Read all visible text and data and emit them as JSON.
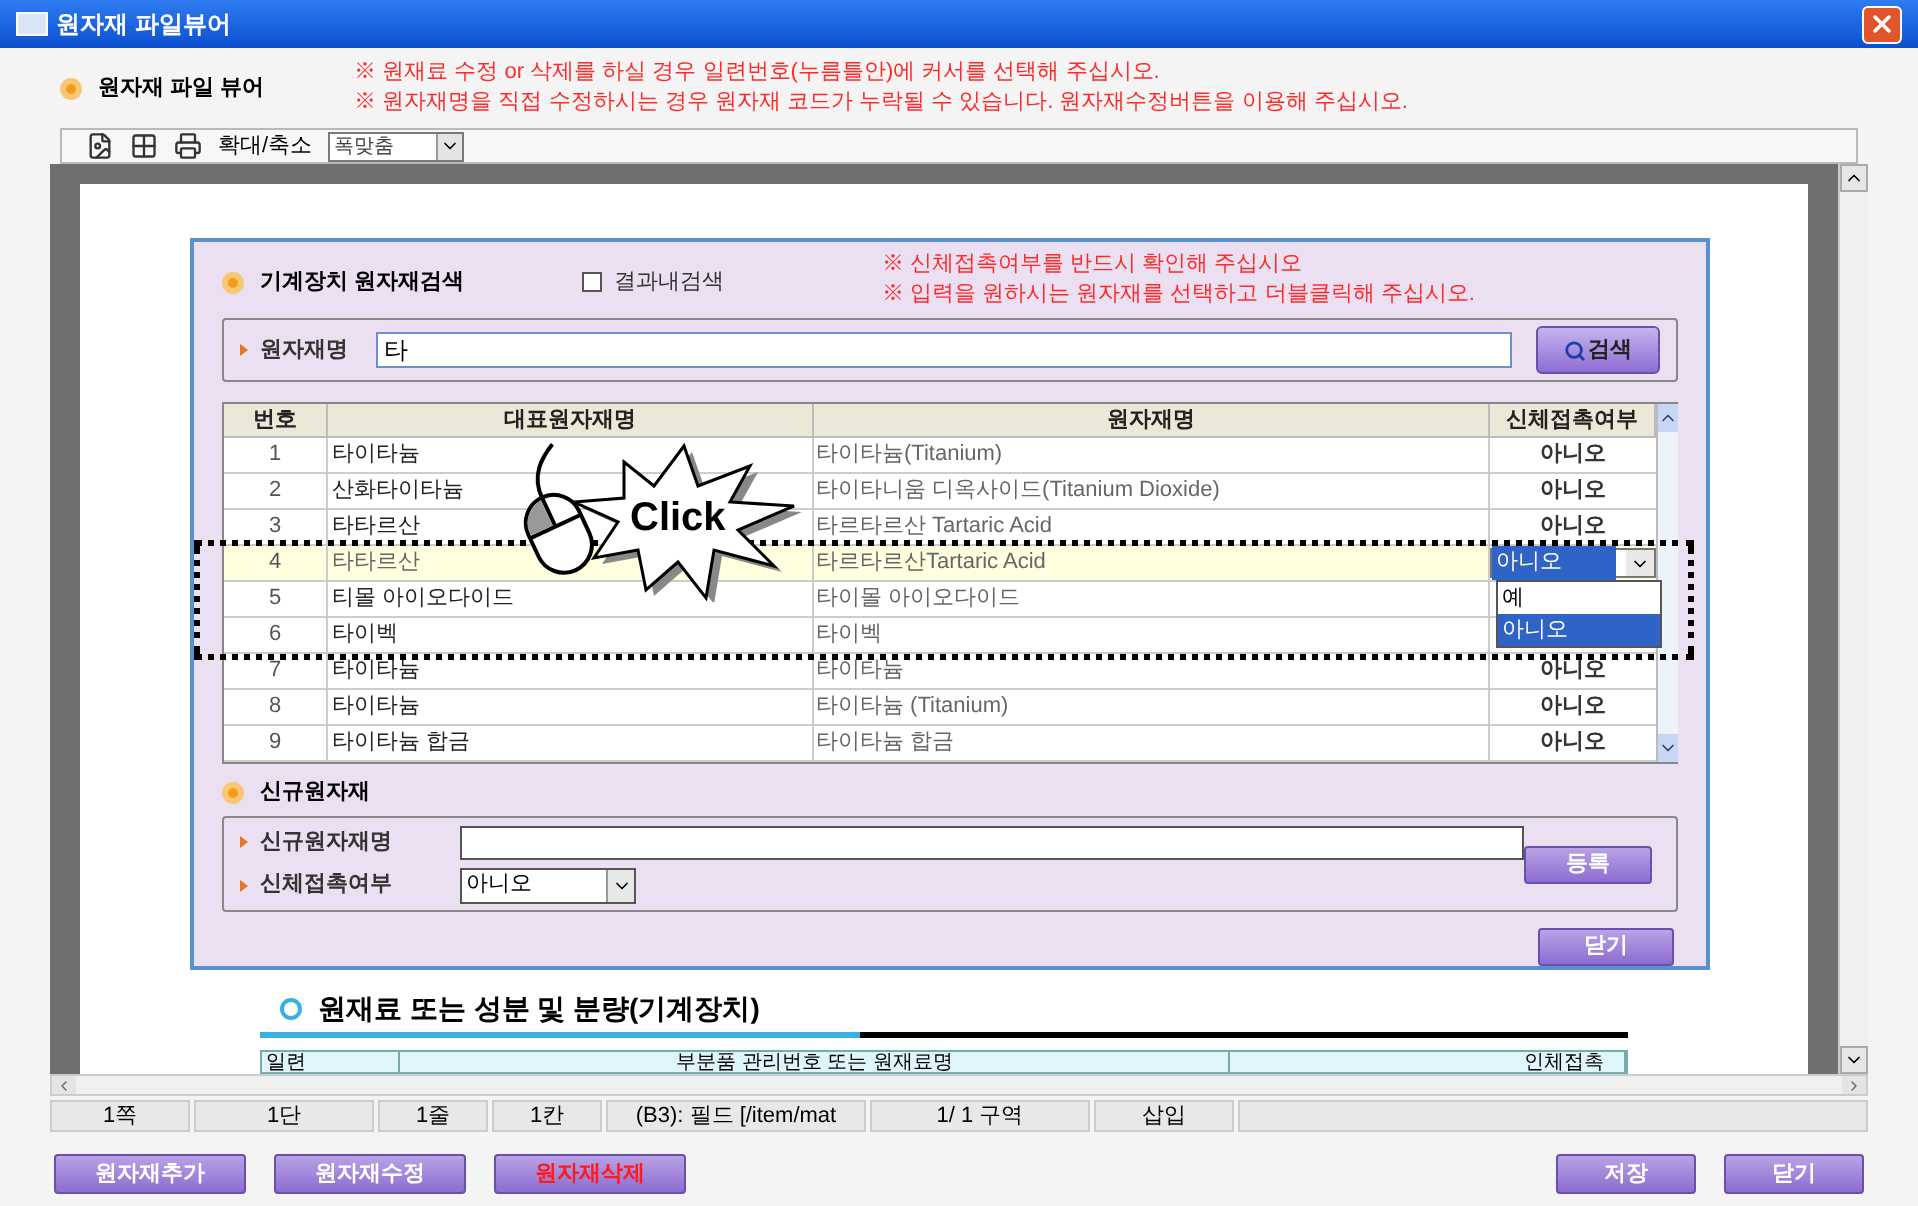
{
  "window": {
    "title": "원자재 파일뷰어"
  },
  "header": {
    "title": "원자재 파일 뷰어",
    "notes": [
      "※ 원재료 수정 or 삭제를 하실 경우 일련번호(누름틀안)에 커서를 선택해 주십시오.",
      "※ 원자재명을 직접 수정하시는 경우 원자재 코드가 누락될 수 있습니다. 원자재수정버튼을 이용해 주십시오."
    ]
  },
  "toolbar": {
    "zoom_label": "확대/축소",
    "zoom_value": "폭맞춤"
  },
  "search_dialog": {
    "title": "기계장치 원자재검색",
    "filter": {
      "label": "결과내검색",
      "checked": false
    },
    "notes": [
      "※ 신체접촉여부를 반드시 확인해 주십시오",
      "※ 입력을 원하시는 원자재를 선택하고 더블클릭해 주십시오."
    ],
    "search": {
      "label": "원자재명",
      "value": "타",
      "button": "검색"
    },
    "table": {
      "columns": [
        "번호",
        "대표원자재명",
        "원자재명",
        "신체접촉여부"
      ],
      "rows": [
        {
          "kind": "plain",
          "no": "1",
          "rep": "타이타늄",
          "name": "타이타늄(Titanium)",
          "contact": "아니오",
          "selected": false
        },
        {
          "kind": "plain",
          "no": "2",
          "rep": "산화타이타늄",
          "name": "타이타니움 디옥사이드(Titanium Dioxide)",
          "contact": "아니오",
          "selected": false
        },
        {
          "kind": "plain",
          "no": "3",
          "rep": "타타르산",
          "name": "타르타르산 Tartaric Acid",
          "contact": "아니오",
          "selected": false
        },
        {
          "kind": "editing",
          "no": "4",
          "rep": "타타르산",
          "name": "타르타르산Tartaric Acid",
          "contact": "아니오",
          "selected": true,
          "options": [
            {
              "label": "예",
              "selected": false
            },
            {
              "label": "아니오",
              "selected": true
            }
          ]
        },
        {
          "kind": "plain",
          "no": "5",
          "rep": "티몰 아이오다이드",
          "name": "타이몰 아이오다이드",
          "selected": false
        },
        {
          "kind": "plain",
          "no": "6",
          "rep": "타이벡",
          "name": "타이벡",
          "selected": false
        },
        {
          "kind": "plain",
          "no": "7",
          "rep": "타이타늄",
          "name": "타이타늄",
          "contact": "아니오",
          "selected": false
        },
        {
          "kind": "plain",
          "no": "8",
          "rep": "타이타늄",
          "name": "타이타늄 (Titanium)",
          "contact": "아니오",
          "selected": false
        },
        {
          "kind": "plain",
          "no": "9",
          "rep": "타이타늄 합금",
          "name": "타이타늄 합금",
          "contact": "아니오",
          "selected": false
        }
      ]
    },
    "new_material": {
      "title": "신규원자재",
      "name_label": "신규원자재명",
      "contact_label": "신체접촉여부",
      "contact_value": "아니오",
      "register_button": "등록"
    },
    "close_button": "닫기"
  },
  "document": {
    "heading": "원재료 또는 성분 및 분량(기계장치)",
    "table_headers": [
      "일련",
      "부분품 관리번호 또는 원재료명",
      "인체접촉"
    ]
  },
  "annotation": {
    "text": "Click"
  },
  "status_bar": [
    "1쪽",
    "1단",
    "1줄",
    "1칸",
    "(B3): 필드 [/item/mat",
    "1/  1 구역",
    "삽입"
  ],
  "buttons": {
    "left": [
      {
        "label": "원자재추가",
        "danger": false
      },
      {
        "label": "원자재수정",
        "danger": false
      },
      {
        "label": "원자재삭제",
        "danger": true
      }
    ],
    "right": [
      {
        "label": "저장",
        "danger": false
      },
      {
        "label": "닫기",
        "danger": false
      }
    ]
  }
}
